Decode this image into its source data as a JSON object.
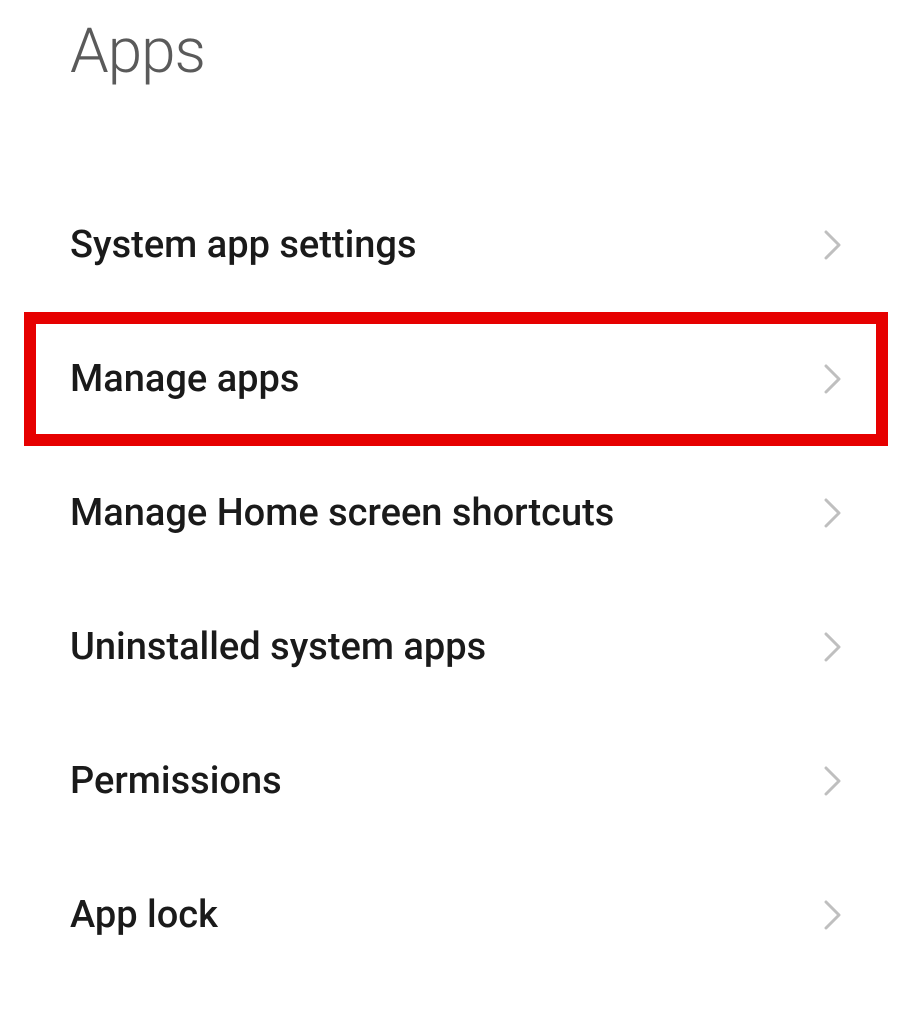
{
  "header": {
    "title": "Apps"
  },
  "settings": {
    "items": [
      {
        "label": "System app settings",
        "highlighted": false
      },
      {
        "label": "Manage apps",
        "highlighted": true
      },
      {
        "label": "Manage Home screen shortcuts",
        "highlighted": false
      },
      {
        "label": "Uninstalled system apps",
        "highlighted": false
      },
      {
        "label": "Permissions",
        "highlighted": false
      },
      {
        "label": "App lock",
        "highlighted": false
      }
    ]
  },
  "colors": {
    "highlight": "#e60000"
  }
}
